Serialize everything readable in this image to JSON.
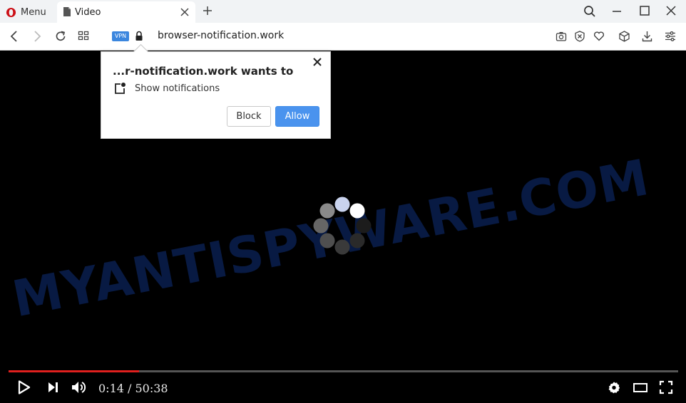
{
  "browser": {
    "menu_label": "Menu",
    "tab_title": "Video",
    "url": "browser-notification.work",
    "vpn_label": "VPN"
  },
  "icons": {
    "browser_logo": "opera-logo-icon",
    "tab_favicon": "page-icon",
    "search": "search-icon",
    "minimize": "minimize-icon",
    "maximize": "maximize-icon",
    "close": "close-icon",
    "back": "back-icon",
    "forward": "forward-icon",
    "reload": "reload-icon",
    "speed_dial": "grid-icon",
    "lock": "lock-icon",
    "snapshot": "camera-icon",
    "adblock": "block-icon",
    "favorite": "heart-icon",
    "flow": "cube-icon",
    "download": "download-icon",
    "easy_setup": "sliders-icon"
  },
  "popup": {
    "title": "...r-notification.work wants to",
    "permission_text": "Show notifications",
    "block_label": "Block",
    "allow_label": "Allow"
  },
  "player": {
    "time_display": "0:14 / 50:38",
    "progress_fraction": 0.195
  },
  "watermark": "MYANTISPYWARE.COM",
  "colors": {
    "accent_blue": "#4a93ee",
    "progress_red": "#e0201e",
    "opera_red": "#cc0f16"
  }
}
